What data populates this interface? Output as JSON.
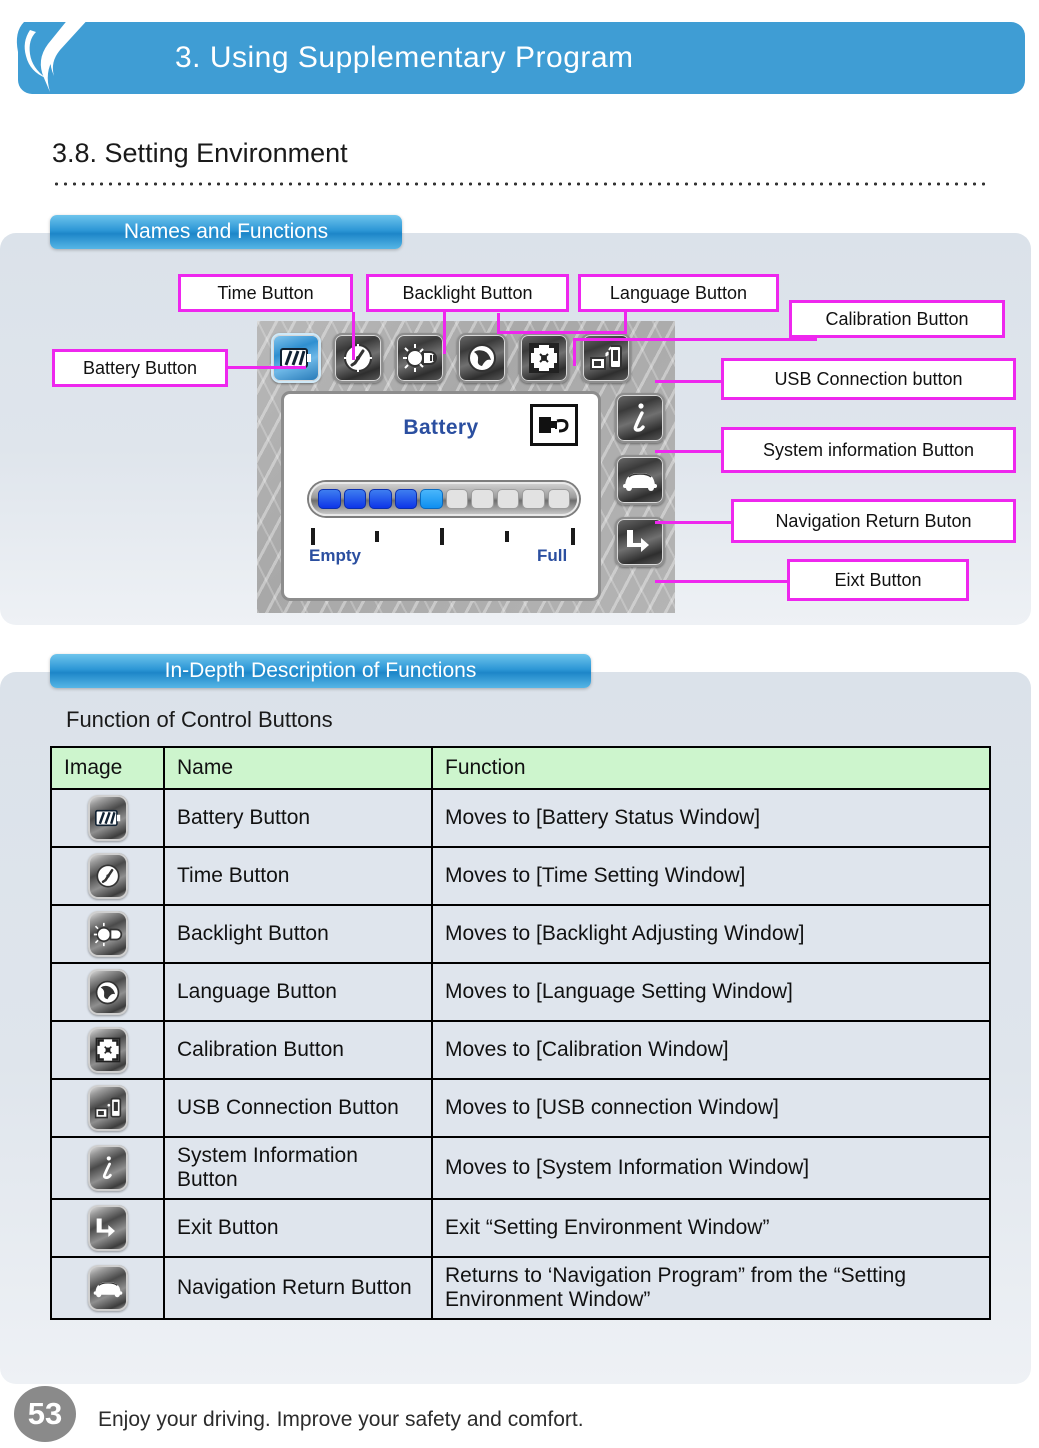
{
  "header": {
    "chapter_title": "3. Using Supplementary Program",
    "logo_icon": "swoosh-logo-icon",
    "brand_color": "#3f9dd4"
  },
  "section": {
    "number_title": "3.8. Setting Environment"
  },
  "names_section": {
    "pill_label": "Names and Functions",
    "callouts": [
      {
        "label": "Battery Button",
        "icon": "battery-icon"
      },
      {
        "label": "Time Button",
        "icon": "clock-icon"
      },
      {
        "label": "Backlight Button",
        "icon": "backlight-bulb-icon"
      },
      {
        "label": "Language Button",
        "icon": "globe-icon"
      },
      {
        "label": "Calibration Button",
        "icon": "calibration-icon"
      },
      {
        "label": "USB Connection button",
        "icon": "usb-connection-icon"
      },
      {
        "label": "System information Button",
        "icon": "info-icon"
      },
      {
        "label": "Navigation Return Buton",
        "icon": "car-icon"
      },
      {
        "label": "Eixt Button",
        "icon": "exit-arrow-icon"
      }
    ],
    "callout_border_color": "#ee27ee",
    "device": {
      "screen_title": "Battery",
      "plug_icon": "power-plug-icon",
      "gauge": {
        "total_segments": 10,
        "filled_segments": 5,
        "empty_label": "Empty",
        "full_label": "Full"
      }
    }
  },
  "depth_section": {
    "pill_label": "In-Depth Description of Functions",
    "sub_title": "Function of Control Buttons",
    "table": {
      "headers": [
        "Image",
        "Name",
        "Function"
      ],
      "header_bg": "#cdf5cd",
      "rows": [
        {
          "icon": "battery-icon",
          "name": "Battery Button",
          "function": "Moves to [Battery Status Window]"
        },
        {
          "icon": "clock-icon",
          "name": "Time Button",
          "function": "Moves to [Time Setting Window]"
        },
        {
          "icon": "backlight-bulb-icon",
          "name": "Backlight Button",
          "function": "Moves to [Backlight Adjusting Window]"
        },
        {
          "icon": "globe-icon",
          "name": "Language Button",
          "function": "Moves to [Language Setting Window]"
        },
        {
          "icon": "calibration-icon",
          "name": "Calibration Button",
          "function": "Moves to [Calibration Window]"
        },
        {
          "icon": "usb-connection-icon",
          "name": "USB Connection Button",
          "function": "Moves to [USB connection Window]"
        },
        {
          "icon": "info-icon",
          "name": "System Information Button",
          "function": "Moves to [System Information Window]"
        },
        {
          "icon": "exit-arrow-icon",
          "name": "Exit Button",
          "function": "Exit “Setting Environment Window”"
        },
        {
          "icon": "car-icon",
          "name": "Navigation Return Button",
          "function": "Returns to ‘Navigation Program” from the “Setting Environment Window”"
        }
      ]
    }
  },
  "footer": {
    "page_number": "53",
    "tagline": "Enjoy your driving. Improve your safety and comfort."
  }
}
